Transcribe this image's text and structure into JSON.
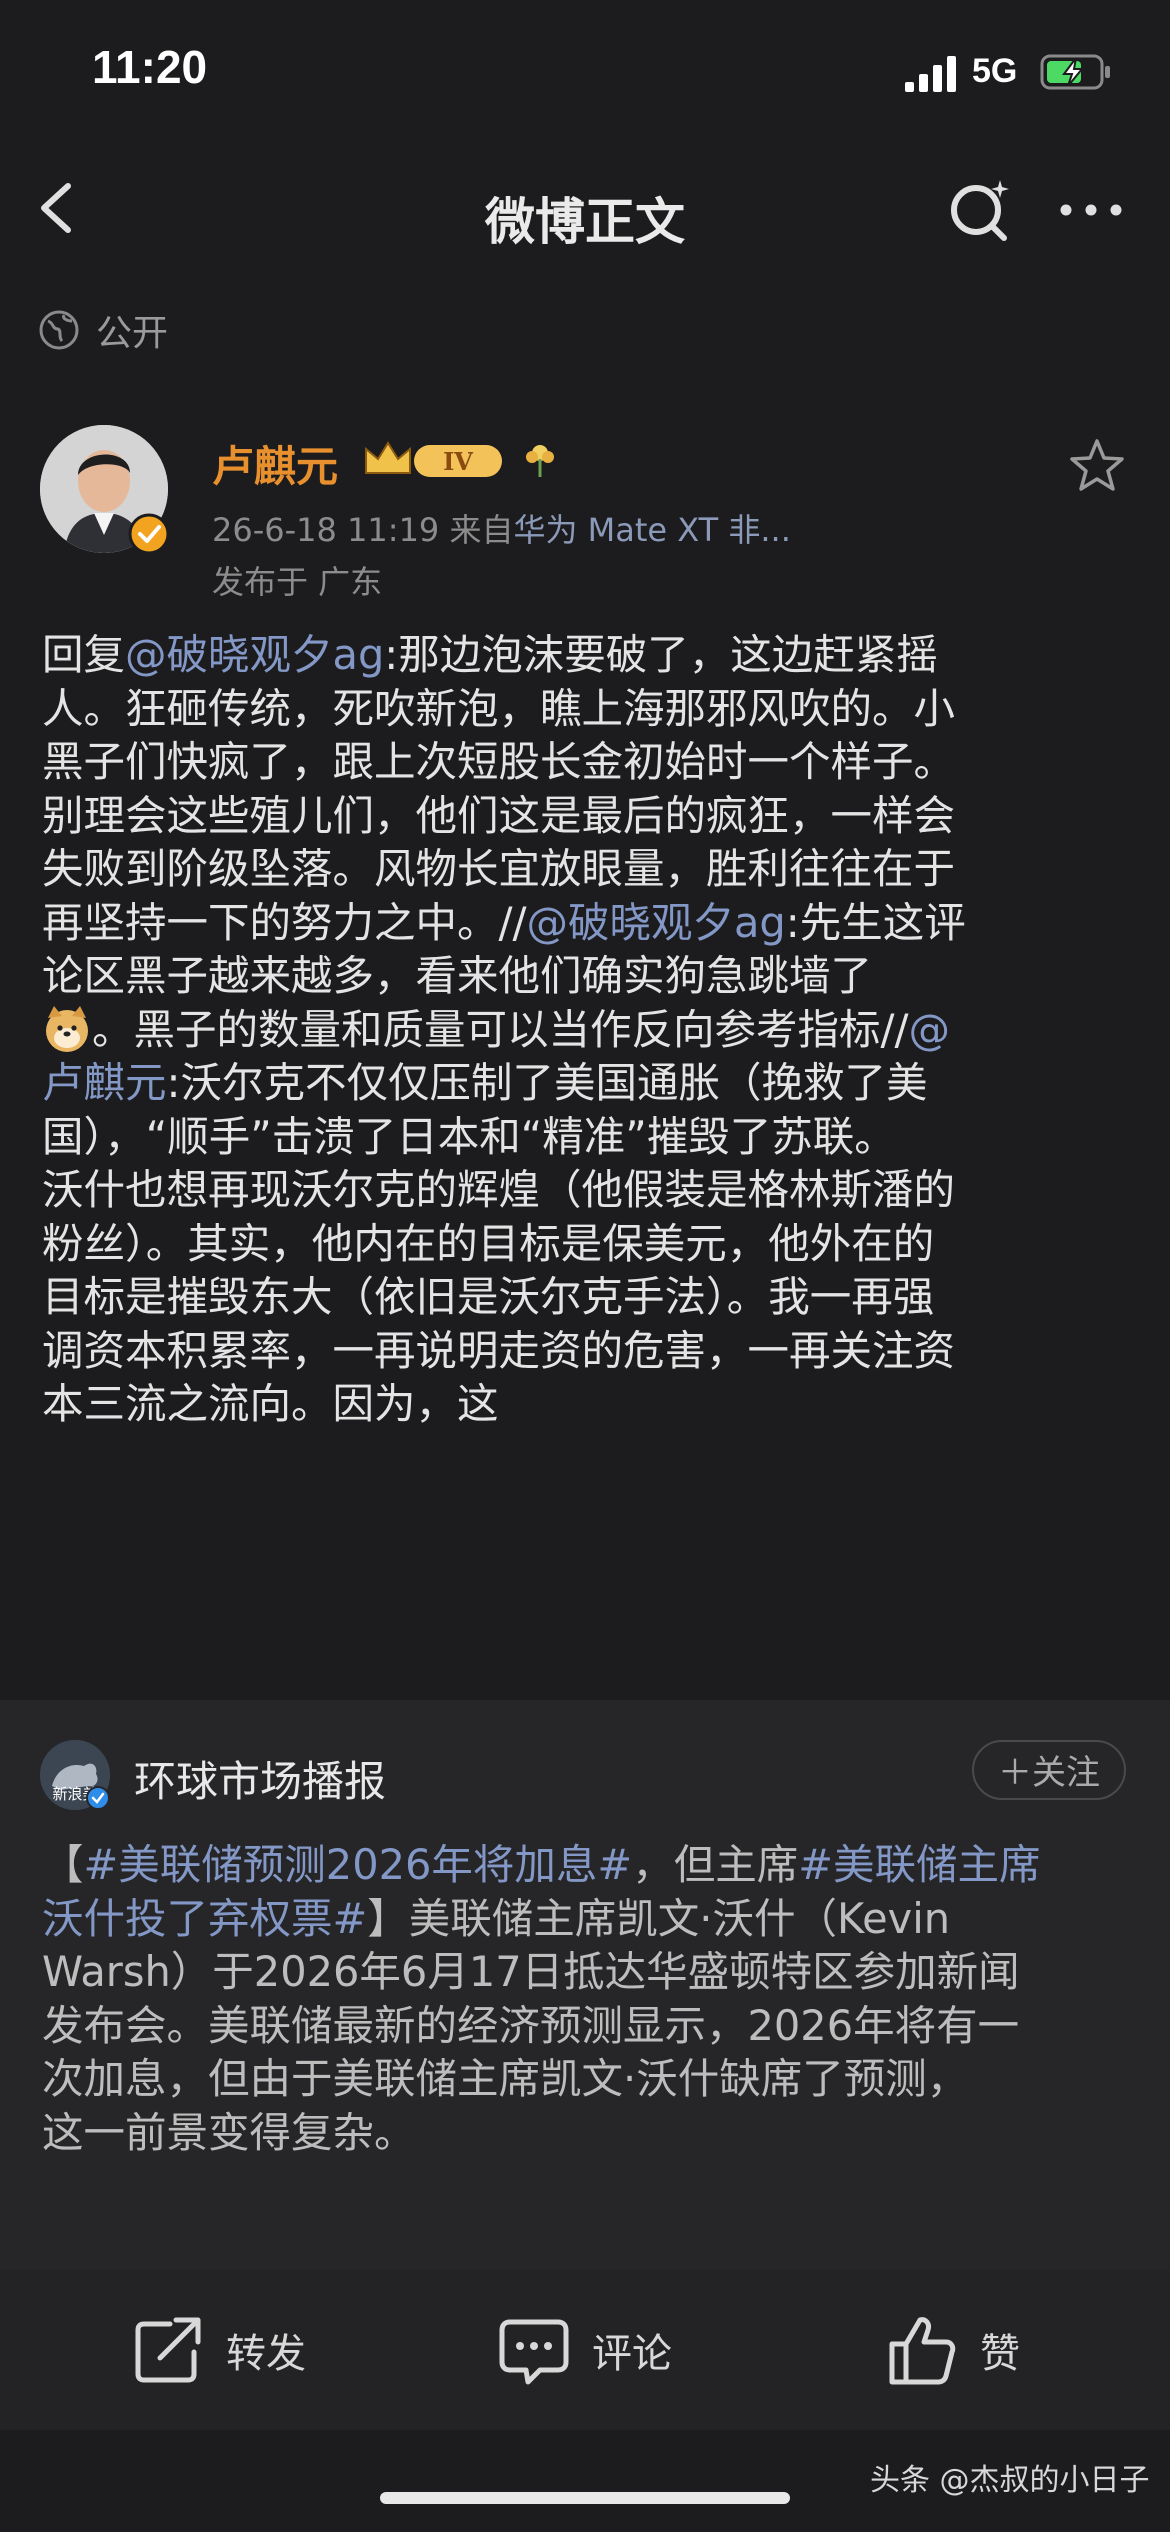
{
  "status_bar": {
    "time": "11:20",
    "network": "5G"
  },
  "nav": {
    "title": "微博正文"
  },
  "visibility": {
    "label": "公开"
  },
  "author": {
    "name": "卢麒元",
    "level_badge": "IV",
    "meta_time": "26-6-18 11:19",
    "meta_from": "来自",
    "meta_device": "华为 Mate XT 非...",
    "location": "发布于 广东"
  },
  "post": {
    "reply_prefix": "回复",
    "mention1": "@破晓观夕ag",
    "text1": ":那边泡沫要破了，这边赶紧摇\n人。狂砸传统，死吹新泡，瞧上海那邪风吹的。小\n黑子们快疯了，跟上次短股长金初始时一个样子。\n别理会这些殖儿们，他们这是最后的疯狂，一样会\n失败到阶级坠落。风物长宜放眼量，胜利往往在于\n再坚持一下的努力之中。//",
    "mention2": "@破晓观夕ag",
    "text2": ":先生这评\n论区黑子越来越多，看来他们确实狗急跳墙了\n",
    "text3": "。黑子的数量和质量可以当作反向参考指标//",
    "mention3": "@\n卢麒元",
    "text4": ":沃尔克不仅仅压制了美国通胀（挽救了美\n国），“顺手”击溃了日本和“精准”摧毁了苏联。\n沃什也想再现沃尔克的辉煌（他假装是格林斯潘的\n粉丝）。其实，他内在的目标是保美元，他外在的\n目标是摧毁东大（依旧是沃尔克手法）。我一再强\n调资本积累率，一再说明走资的危害，一再关注资\n本三流之流向。因为，这"
  },
  "repost": {
    "avatar_text": "新浪美",
    "name": "环球市场播报",
    "follow_label": "＋关注",
    "bracket_open": "【",
    "hashtag1": "#美联储预测2026年将加息#",
    "text1": "，但主席",
    "hashtag2": "#美联储主席\n沃什投了弃权票#",
    "text2": "】美联储主席凯文·沃什（Kevin\nWarsh）于2026年6月17日抵达华盛顿特区参加新闻\n发布会。美联储最新的经济预测显示，2026年将有一\n次加息，但由于美联储主席凯文·沃什缺席了预测，\n这一前景变得复杂。"
  },
  "actions": {
    "forward": "转发",
    "comment": "评论",
    "like": "赞"
  },
  "watermark": "头条 @杰叔的小日子",
  "colors": {
    "background": "#1c1c1e",
    "card": "#262628",
    "accent_orange": "#e8902e",
    "link": "#8398c6"
  }
}
